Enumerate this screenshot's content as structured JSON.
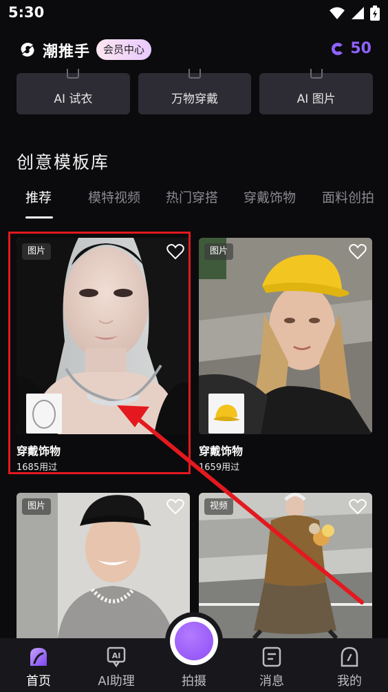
{
  "status": {
    "time": "5:30"
  },
  "header": {
    "app_title": "潮推手",
    "member_badge": "会员中心",
    "coins": "50"
  },
  "tools": [
    {
      "label": "AI 试衣"
    },
    {
      "label": "万物穿戴"
    },
    {
      "label": "AI 图片"
    }
  ],
  "section": {
    "title": "创意模板库"
  },
  "tabs": [
    {
      "label": "推荐"
    },
    {
      "label": "模特视频"
    },
    {
      "label": "热门穿搭"
    },
    {
      "label": "穿戴饰物"
    },
    {
      "label": "面料创拍"
    }
  ],
  "cards": [
    {
      "badge": "图片",
      "title": "穿戴饰物",
      "count": "1685用过"
    },
    {
      "badge": "图片",
      "title": "穿戴饰物",
      "count": "1659用过"
    },
    {
      "badge": "图片"
    },
    {
      "badge": "视频"
    }
  ],
  "nav": {
    "home": "首页",
    "assistant": "AI助理",
    "shoot": "拍摄",
    "messages": "消息",
    "profile": "我的"
  },
  "colors": {
    "accent": "#8e63ff",
    "highlight": "#e3191f",
    "background": "#0b0b0d"
  }
}
